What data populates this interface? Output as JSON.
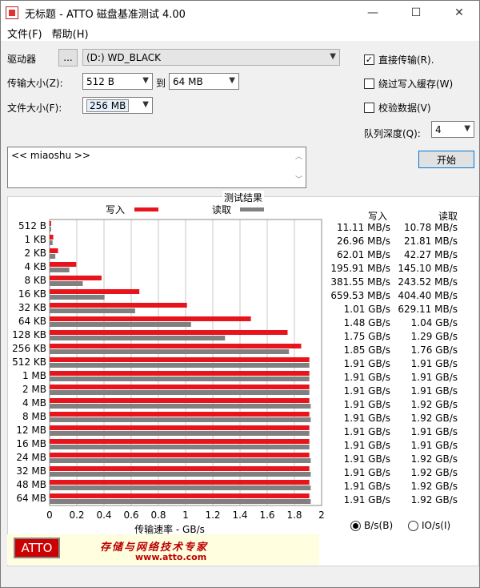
{
  "window": {
    "title": "无标题 - ATTO 磁盘基准测试 4.00",
    "minimize": "—",
    "maximize": "☐",
    "close": "✕"
  },
  "menu": {
    "file": "文件(F)",
    "help": "帮助(H)"
  },
  "form": {
    "drive_label": "驱动器",
    "drive_browse": "...",
    "drive_value": "(D:) WD_BLACK",
    "transfer_label": "传输大小(Z):",
    "transfer_from": "512 B",
    "transfer_to_word": "到",
    "transfer_to": "64 MB",
    "file_size_label": "文件大小(F):",
    "file_size": "256 MB",
    "description": "<< miaoshu >>"
  },
  "options": {
    "direct_io": "直接传输(R).",
    "direct_io_checked": true,
    "bypass_cache": "绕过写入缓存(W)",
    "bypass_cache_checked": false,
    "verify": "校验数据(V)",
    "verify_checked": false,
    "queue_label": "队列深度(Q):",
    "queue_value": "4",
    "start_button": "开始"
  },
  "results": {
    "title": "测试结果",
    "write_legend": "写入",
    "read_legend": "读取",
    "col_write": "写入",
    "col_read": "读取",
    "x_axis_title": "传输速率 - GB/s",
    "rows": [
      {
        "size": "512 B",
        "write": "11.11 MB/s",
        "read": "10.78 MB/s"
      },
      {
        "size": "1 KB",
        "write": "26.96 MB/s",
        "read": "21.81 MB/s"
      },
      {
        "size": "2 KB",
        "write": "62.01 MB/s",
        "read": "42.27 MB/s"
      },
      {
        "size": "4 KB",
        "write": "195.91 MB/s",
        "read": "145.10 MB/s"
      },
      {
        "size": "8 KB",
        "write": "381.55 MB/s",
        "read": "243.52 MB/s"
      },
      {
        "size": "16 KB",
        "write": "659.53 MB/s",
        "read": "404.40 MB/s"
      },
      {
        "size": "32 KB",
        "write": "1.01 GB/s",
        "read": "629.11 MB/s"
      },
      {
        "size": "64 KB",
        "write": "1.48 GB/s",
        "read": "1.04 GB/s"
      },
      {
        "size": "128 KB",
        "write": "1.75 GB/s",
        "read": "1.29 GB/s"
      },
      {
        "size": "256 KB",
        "write": "1.85 GB/s",
        "read": "1.76 GB/s"
      },
      {
        "size": "512 KB",
        "write": "1.91 GB/s",
        "read": "1.91 GB/s"
      },
      {
        "size": "1 MB",
        "write": "1.91 GB/s",
        "read": "1.91 GB/s"
      },
      {
        "size": "2 MB",
        "write": "1.91 GB/s",
        "read": "1.91 GB/s"
      },
      {
        "size": "4 MB",
        "write": "1.91 GB/s",
        "read": "1.92 GB/s"
      },
      {
        "size": "8 MB",
        "write": "1.91 GB/s",
        "read": "1.92 GB/s"
      },
      {
        "size": "12 MB",
        "write": "1.91 GB/s",
        "read": "1.91 GB/s"
      },
      {
        "size": "16 MB",
        "write": "1.91 GB/s",
        "read": "1.91 GB/s"
      },
      {
        "size": "24 MB",
        "write": "1.91 GB/s",
        "read": "1.92 GB/s"
      },
      {
        "size": "32 MB",
        "write": "1.91 GB/s",
        "read": "1.92 GB/s"
      },
      {
        "size": "48 MB",
        "write": "1.91 GB/s",
        "read": "1.92 GB/s"
      },
      {
        "size": "64 MB",
        "write": "1.91 GB/s",
        "read": "1.92 GB/s"
      }
    ],
    "unit_bytes": "B/s(B)",
    "unit_io": "IO/s(I)",
    "unit_bytes_selected": true
  },
  "footer": {
    "logo": "ATTO",
    "slogan": "存储与网络技术专家",
    "url": "www.atto.com"
  },
  "chart_data": {
    "type": "bar",
    "categories": [
      "512 B",
      "1 KB",
      "2 KB",
      "4 KB",
      "8 KB",
      "16 KB",
      "32 KB",
      "64 KB",
      "128 KB",
      "256 KB",
      "512 KB",
      "1 MB",
      "2 MB",
      "4 MB",
      "8 MB",
      "12 MB",
      "16 MB",
      "24 MB",
      "32 MB",
      "48 MB",
      "64 MB"
    ],
    "series": [
      {
        "name": "写入",
        "color": "#e8141b",
        "values": [
          0.011,
          0.027,
          0.062,
          0.196,
          0.382,
          0.66,
          1.01,
          1.48,
          1.75,
          1.85,
          1.91,
          1.91,
          1.91,
          1.91,
          1.91,
          1.91,
          1.91,
          1.91,
          1.91,
          1.91,
          1.91
        ]
      },
      {
        "name": "读取",
        "color": "#808080",
        "values": [
          0.011,
          0.022,
          0.042,
          0.145,
          0.244,
          0.404,
          0.629,
          1.04,
          1.29,
          1.76,
          1.91,
          1.91,
          1.91,
          1.92,
          1.92,
          1.91,
          1.91,
          1.92,
          1.92,
          1.92,
          1.92
        ]
      }
    ],
    "x_ticks": [
      "0",
      "0.2",
      "0.4",
      "0.6",
      "0.8",
      "1",
      "1.2",
      "1.4",
      "1.6",
      "1.8",
      "2"
    ],
    "xlim": [
      0,
      2
    ],
    "orientation": "horizontal",
    "grid": true
  }
}
